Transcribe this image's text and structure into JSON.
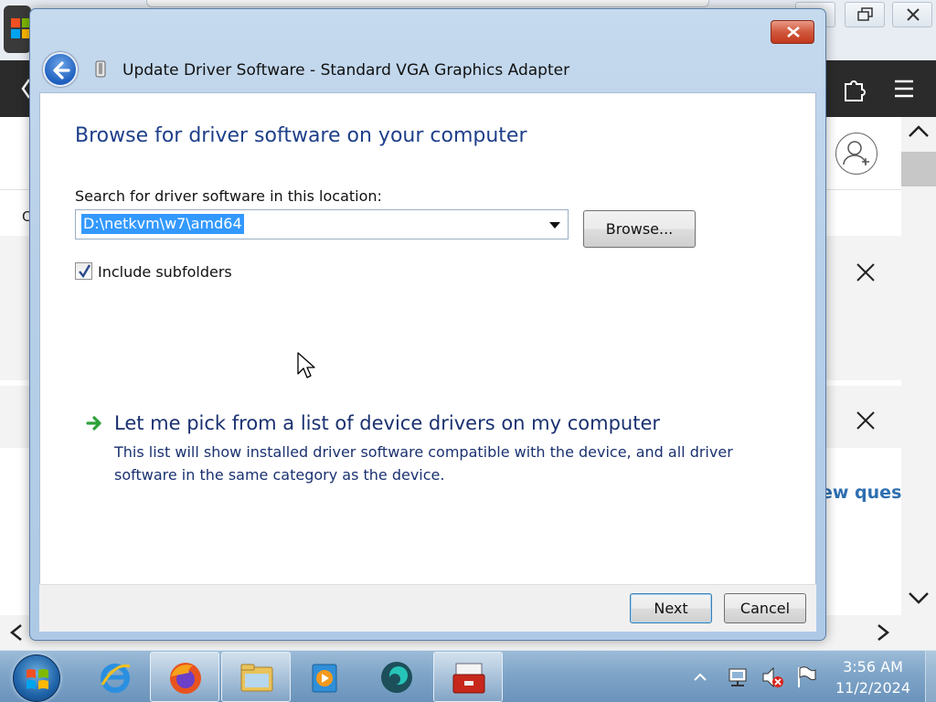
{
  "dialog": {
    "title": "Update Driver Software - Standard VGA Graphics Adapter",
    "heading": "Browse for driver software on your computer",
    "search_label": "Search for driver software in this location:",
    "path_value": "D:\\netkvm\\w7\\amd64",
    "browse_label": "Browse...",
    "include_subfolders_label": "Include subfolders",
    "include_subfolders_checked": true,
    "pick_option_title": "Let me pick from a list of device drivers on my computer",
    "pick_option_desc": "This list will show installed driver software compatible with the device, and all driver software in the same category as the device.",
    "next_label": "Next",
    "cancel_label": "Cancel"
  },
  "background": {
    "link_text": "ew quest",
    "row_letter": "C"
  },
  "taskbar": {
    "apps": [
      "internet-explorer",
      "firefox",
      "file-explorer",
      "media-player",
      "app-teal",
      "toolbox"
    ],
    "active_app": "toolbox",
    "time": "3:56 AM",
    "date": "11/2/2024"
  },
  "colors": {
    "heading": "#1e3f8a",
    "selection": "#3399ff",
    "close_button": "#c7452a",
    "taskbar": "#7fa5c8"
  }
}
